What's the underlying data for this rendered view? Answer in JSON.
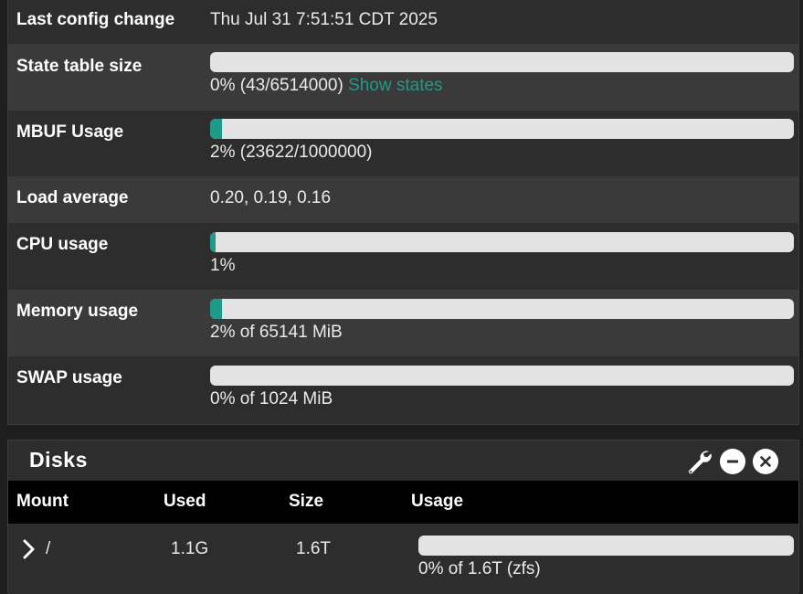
{
  "system": {
    "last_config": {
      "label": "Last config change",
      "value": "Thu Jul 31 7:51:51 CDT 2025"
    },
    "state_table": {
      "label": "State table size",
      "text": "0% (43/6514000)",
      "link": "Show states",
      "percent": 0
    },
    "mbuf": {
      "label": "MBUF Usage",
      "text": "2% (23622/1000000)",
      "percent": 2
    },
    "load": {
      "label": "Load average",
      "value": "0.20, 0.19, 0.16"
    },
    "cpu": {
      "label": "CPU usage",
      "text": "1%",
      "percent": 1
    },
    "memory": {
      "label": "Memory usage",
      "text": "2% of 65141 MiB",
      "percent": 2
    },
    "swap": {
      "label": "SWAP usage",
      "text": "0% of 1024 MiB",
      "percent": 0
    }
  },
  "disks": {
    "title": "Disks",
    "icons": [
      "wrench-icon",
      "minus-circle-icon",
      "close-circle-icon"
    ],
    "columns": [
      "Mount",
      "Used",
      "Size",
      "Usage"
    ],
    "rows": [
      {
        "mount": "/",
        "used": "1.1G",
        "size": "1.6T",
        "usage_text": "0% of 1.6T (zfs)",
        "percent": 0
      }
    ]
  },
  "colors": {
    "accent": "#1f9a88",
    "bar_bg": "#e3e3e3",
    "panel": "#2d2d2d",
    "row_alt": "#3a3a3a",
    "header": "#000000"
  }
}
